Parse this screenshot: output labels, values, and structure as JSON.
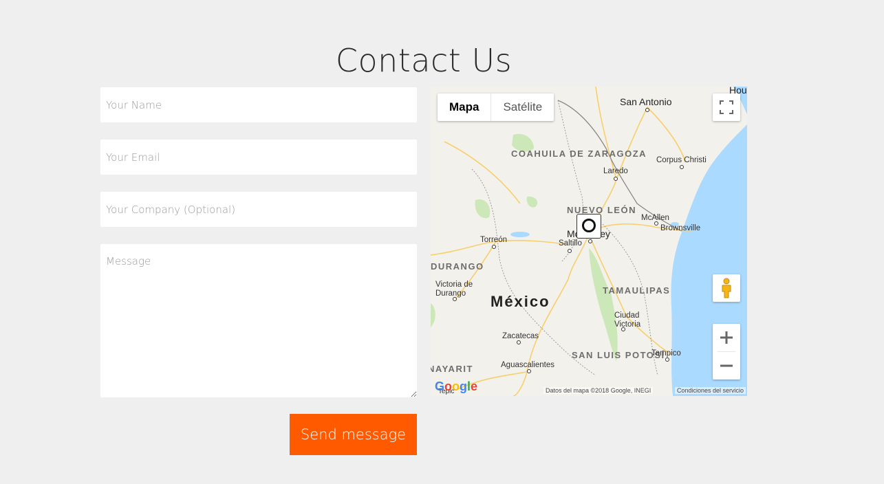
{
  "page": {
    "title": "Contact Us"
  },
  "form": {
    "name_placeholder": "Your Name",
    "email_placeholder": "Your Email",
    "company_placeholder": "Your Company (Optional)",
    "message_placeholder": "Message",
    "submit_label": "Send message"
  },
  "map": {
    "type_controls": {
      "map": "Mapa",
      "satellite": "Satélite"
    },
    "country": "México",
    "states": [
      "COAHUILA DE ZARAGOZA",
      "NUEVO LEÓN",
      "DURANGO",
      "TAMAULIPAS",
      "SAN LUIS POTOSÍ",
      "NAYARIT"
    ],
    "cities": [
      "Houston",
      "San Antonio",
      "Laredo",
      "Corpus Christi",
      "McAllen",
      "Brownsville",
      "Monterrey",
      "Saltillo",
      "Torreón",
      "Victoria de Durango",
      "Ciudad Victoria",
      "Zacatecas",
      "Aguascalientes",
      "Tampico",
      "Tepic"
    ],
    "attribution": "Datos del mapa ©2018 Google, INEGI",
    "terms": "Condiciones del servicio",
    "logo": "Google",
    "icons": [
      "fullscreen-icon",
      "pegman-icon",
      "zoom-in-icon",
      "zoom-out-icon",
      "marker-icon"
    ],
    "colors": {
      "water": "#aadaff",
      "land": "#f3f1ec",
      "park": "#cde8b8",
      "road": "#f7cf6b"
    }
  },
  "colors": {
    "accent": "#ff5a00",
    "background": "#efefef"
  }
}
